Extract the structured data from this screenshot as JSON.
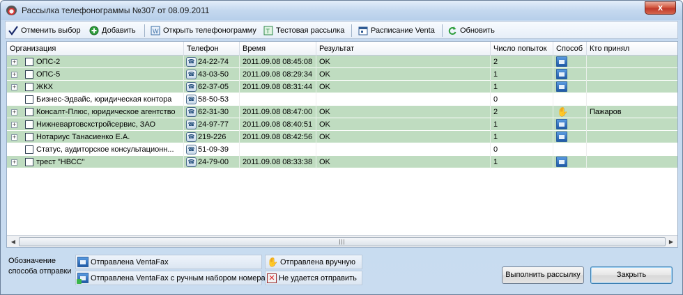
{
  "window": {
    "title": "Рассылка телефонограммы №307 от 08.09.2011",
    "close_label": "x"
  },
  "toolbar": {
    "items": [
      {
        "label": "Отменить выбор",
        "icon": "checkmark-icon"
      },
      {
        "label": "Добавить",
        "icon": "add-icon"
      },
      {
        "label": "Открыть телефонограмму",
        "icon": "open-document-icon"
      },
      {
        "label": "Тестовая рассылка",
        "icon": "test-mailing-icon"
      },
      {
        "label": "Расписание Venta",
        "icon": "calendar-icon"
      },
      {
        "label": "Обновить",
        "icon": "refresh-icon"
      }
    ]
  },
  "grid": {
    "columns": [
      "Организация",
      "Телефон",
      "Время",
      "Результат",
      "Число попыток",
      "Способ",
      "Кто принял"
    ],
    "rows": [
      {
        "org": "ОПС-2",
        "phone": "24-22-74",
        "time": "2011.09.08 08:45:08",
        "result": "OK",
        "attempts": "2",
        "method": "fax",
        "accepted_by": "",
        "status": "green",
        "expandable": true
      },
      {
        "org": "ОПС-5",
        "phone": "43-03-50",
        "time": "2011.09.08 08:29:34",
        "result": "OK",
        "attempts": "1",
        "method": "fax",
        "accepted_by": "",
        "status": "green",
        "expandable": true
      },
      {
        "org": "ЖКХ",
        "phone": "62-37-05",
        "time": "2011.09.08 08:31:44",
        "result": "OK",
        "attempts": "1",
        "method": "fax",
        "accepted_by": "",
        "status": "green",
        "expandable": true
      },
      {
        "org": "Бизнес-Эдвайс, юридическая контора",
        "phone": "58-50-53",
        "time": "",
        "result": "",
        "attempts": "0",
        "method": "",
        "accepted_by": "",
        "status": "white",
        "expandable": false
      },
      {
        "org": "Консалт-Плюс, юридическое агентство",
        "phone": "62-31-30",
        "time": "2011.09.08 08:47:00",
        "result": "OK",
        "attempts": "2",
        "method": "manual",
        "accepted_by": "Пажаров",
        "status": "green",
        "expandable": true
      },
      {
        "org": "Нижневартовскстройсервис, ЗАО",
        "phone": "24-97-77",
        "time": "2011.09.08 08:40:51",
        "result": "OK",
        "attempts": "1",
        "method": "fax",
        "accepted_by": "",
        "status": "green",
        "expandable": true
      },
      {
        "org": "Нотариус Танасиенко Е.А.",
        "phone": "219-226",
        "time": "2011.09.08 08:42:56",
        "result": "OK",
        "attempts": "1",
        "method": "fax",
        "accepted_by": "",
        "status": "green",
        "expandable": true
      },
      {
        "org": "Статус, аудиторское консультационн...",
        "phone": "51-09-39",
        "time": "",
        "result": "",
        "attempts": "0",
        "method": "",
        "accepted_by": "",
        "status": "white",
        "expandable": false
      },
      {
        "org": "трест \"НВСС\"",
        "phone": "24-79-00",
        "time": "2011.09.08 08:33:38",
        "result": "OK",
        "attempts": "1",
        "method": "fax",
        "accepted_by": "",
        "status": "green",
        "expandable": true
      }
    ]
  },
  "legend": {
    "caption": "Обозначение способа отправки",
    "items": [
      {
        "label": "Отправлена VentaFax",
        "icon": "ventafax-icon"
      },
      {
        "label": "Отправлена VentaFax с ручным набором номера",
        "icon": "ventafax-manual-icon"
      },
      {
        "label": "Отправлена вручную",
        "icon": "hand-icon"
      },
      {
        "label": "Не удается отправить",
        "icon": "failed-icon"
      }
    ]
  },
  "buttons": {
    "send": "Выполнить рассылку",
    "close": "Закрыть"
  },
  "colors": {
    "row_ok": "#bfdcc0",
    "row_pending": "#ffffff",
    "close_button": "#c0392b"
  }
}
